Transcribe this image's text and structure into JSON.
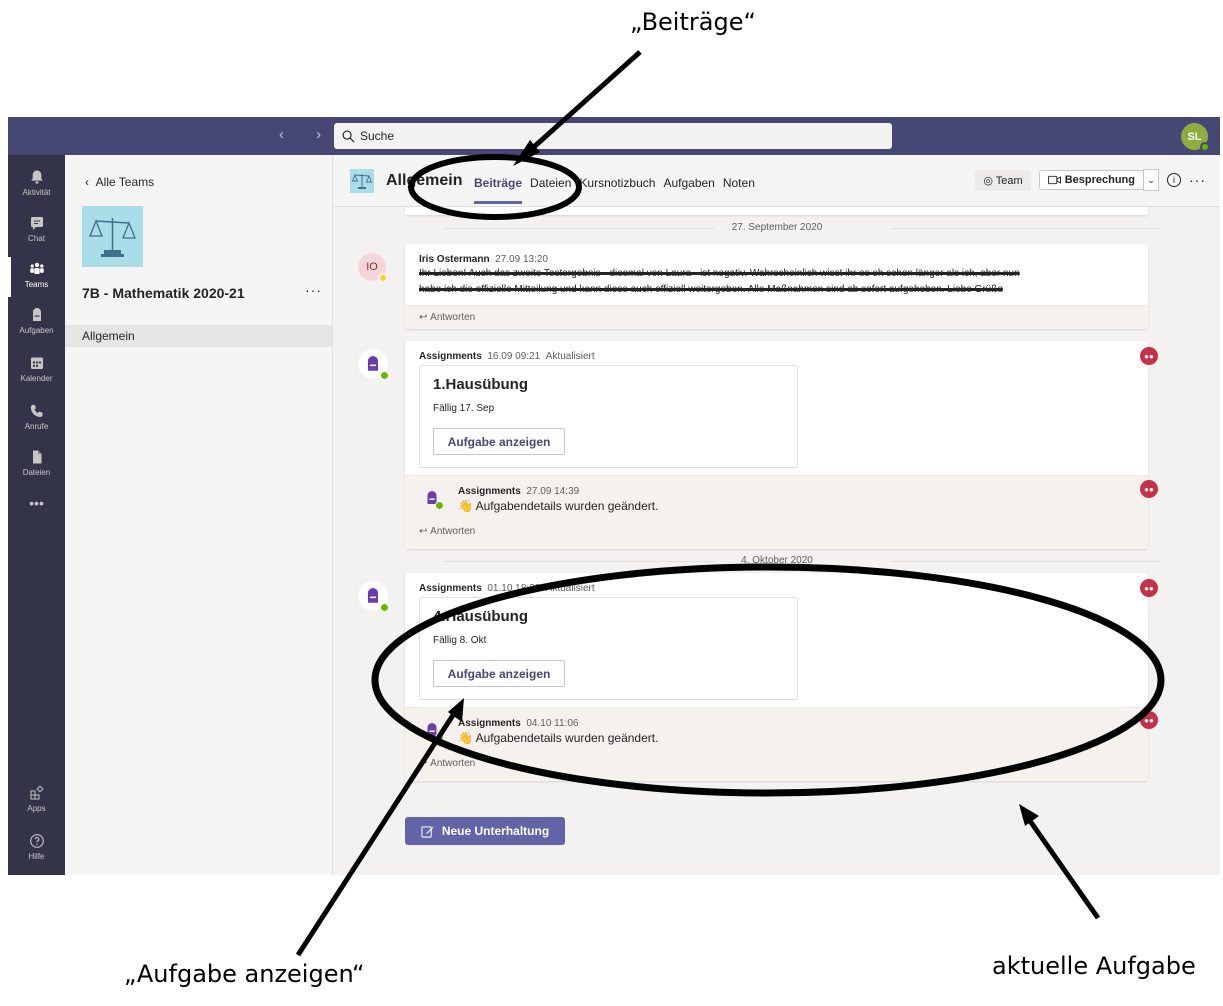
{
  "annotations": {
    "beitraege": "„Beiträge“",
    "aufgabe_anzeigen": "„Aufgabe anzeigen“",
    "aktuelle_aufgabe": "aktuelle Aufgabe"
  },
  "topbar": {
    "search_placeholder": "Suche",
    "user_initials": "SL"
  },
  "rail": {
    "items": [
      {
        "label": "Aktivität",
        "icon": "bell-icon"
      },
      {
        "label": "Chat",
        "icon": "chat-icon"
      },
      {
        "label": "Teams",
        "icon": "teams-icon"
      },
      {
        "label": "Aufgaben",
        "icon": "backpack-icon"
      },
      {
        "label": "Kalender",
        "icon": "calendar-icon"
      },
      {
        "label": "Anrufe",
        "icon": "phone-icon"
      },
      {
        "label": "Dateien",
        "icon": "file-icon"
      },
      {
        "label": "Apps",
        "icon": "apps-icon"
      },
      {
        "label": "Hilfe",
        "icon": "help-icon"
      }
    ],
    "more": "•••"
  },
  "pane": {
    "back": "Alle Teams",
    "team_name": "7B - Mathematik 2020-21",
    "more": "···",
    "channel": "Allgemein"
  },
  "channel": {
    "title": "Allgemein",
    "tabs": [
      "Beiträge",
      "Dateien",
      "Kursnotizbuch",
      "Aufgaben",
      "Noten"
    ],
    "team_button": "Team",
    "meet_button": "Besprechung"
  },
  "feed": {
    "date1": "27. September 2020",
    "post1": {
      "author": "Iris Ostermann",
      "time": "27.09 13:20",
      "initials": "IO",
      "line1": "Ihr Lieben! Auch das zweite Testergebnis - diesmal von Laura - ist negativ. Wahrscheinlich wisst ihr es eh schon länger als ich, aber nun",
      "line2": "habe ich die offizielle Mitteilung und kann diese auch offiziell weitergeben. Alle Maßnahmen sind ab sofort aufgehoben. Liebe Grüße",
      "reply": "Antworten"
    },
    "post2": {
      "author": "Assignments",
      "time": "16.09 09:21",
      "edited": "Aktualisiert",
      "card_title": "1.Hausübung",
      "due": "Fällig 17. Sep",
      "button": "Aufgabe anzeigen",
      "sub_author": "Assignments",
      "sub_time": "27.09 14:39",
      "sub_text": "Aufgabendetails wurden geändert.",
      "reply": "Antworten"
    },
    "date2": "4. Oktober 2020",
    "post3": {
      "author": "Assignments",
      "time": "01.10 18:22",
      "edited": "Aktualisiert",
      "card_title": "4.Hausübung",
      "due": "Fällig 8. Okt",
      "button": "Aufgabe anzeigen",
      "sub_author": "Assignments",
      "sub_time": "04.10 11:06",
      "sub_text": "Aufgabendetails wurden geändert.",
      "reply": "Antworten"
    },
    "new_conversation": "Neue Unterhaltung"
  }
}
